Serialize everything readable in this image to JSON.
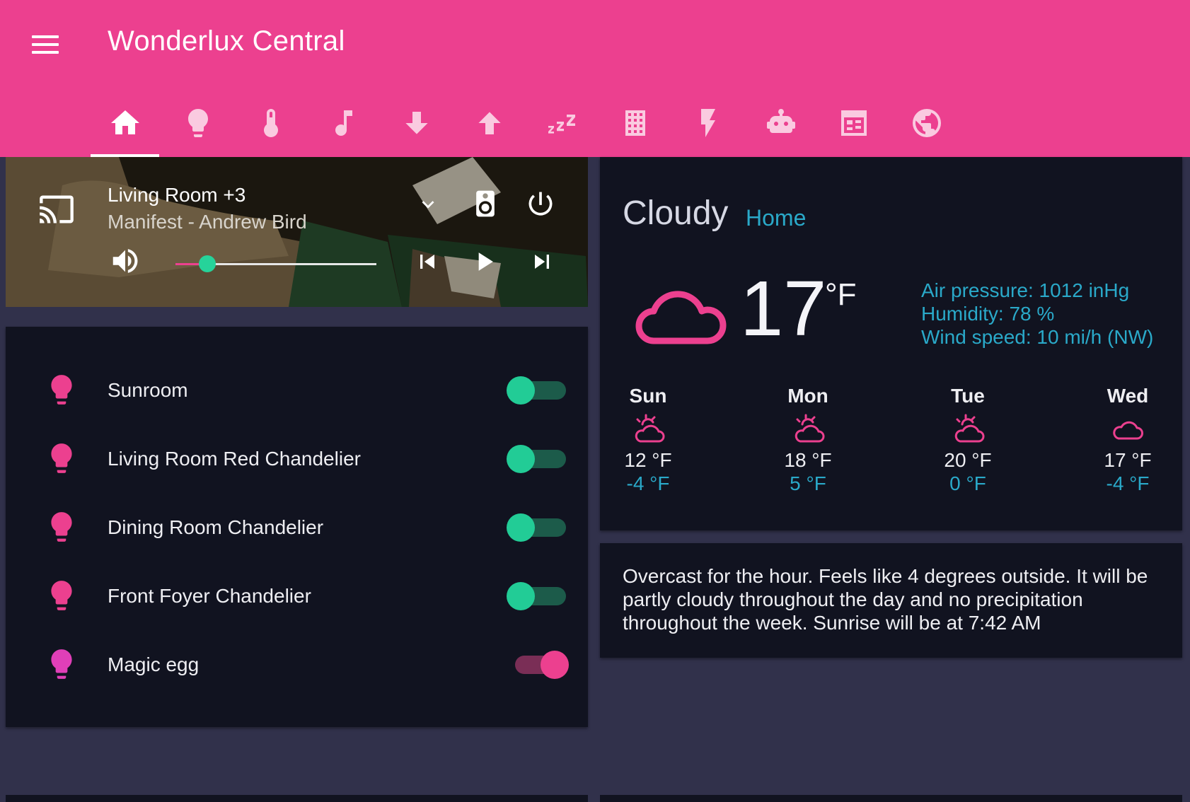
{
  "app": {
    "title": "Wonderlux Central",
    "accent": "#ec408f"
  },
  "tabs": [
    {
      "icon": "home-icon",
      "active": true
    },
    {
      "icon": "lightbulb-icon",
      "active": false
    },
    {
      "icon": "thermometer-icon",
      "active": false
    },
    {
      "icon": "music-note-icon",
      "active": false
    },
    {
      "icon": "arrow-down-icon",
      "active": false
    },
    {
      "icon": "arrow-up-icon",
      "active": false
    },
    {
      "icon": "sleep-icon",
      "active": false
    },
    {
      "icon": "building-icon",
      "active": false
    },
    {
      "icon": "lightning-icon",
      "active": false
    },
    {
      "icon": "robot-icon",
      "active": false
    },
    {
      "icon": "calendar-icon",
      "active": false
    },
    {
      "icon": "globe-icon",
      "active": false
    }
  ],
  "media": {
    "source": "Living Room +3",
    "now_playing": "Manifest - Andrew Bird",
    "volume_fraction": 0.16,
    "icons": [
      "cast-icon",
      "chevron-down-icon",
      "speaker-icon",
      "power-icon",
      "volume-icon",
      "skip-previous-icon",
      "play-icon",
      "skip-next-icon"
    ]
  },
  "lights": [
    {
      "name": "Sunroom",
      "on": false,
      "icon_color": "#ec408f"
    },
    {
      "name": "Living Room Red Chandelier",
      "on": false,
      "icon_color": "#ec408f"
    },
    {
      "name": "Dining Room Chandelier",
      "on": false,
      "icon_color": "#ec408f"
    },
    {
      "name": "Front Foyer Chandelier",
      "on": false,
      "icon_color": "#ec408f"
    },
    {
      "name": "Magic egg",
      "on": true,
      "icon_color": "#e03fb8"
    }
  ],
  "weather": {
    "condition": "Cloudy",
    "location": "Home",
    "temperature": "17",
    "unit": "°F",
    "air_pressure": "Air pressure: 1012 inHg",
    "humidity": "Humidity: 78 %",
    "wind_speed": "Wind speed: 10 mi/h (NW)",
    "forecast": [
      {
        "day": "Sun",
        "high": "12 °F",
        "low": "-4 °F",
        "icon": "partly-cloudy-icon"
      },
      {
        "day": "Mon",
        "high": "18 °F",
        "low": "5 °F",
        "icon": "partly-cloudy-icon"
      },
      {
        "day": "Tue",
        "high": "20 °F",
        "low": "0 °F",
        "icon": "partly-cloudy-icon"
      },
      {
        "day": "Wed",
        "high": "17 °F",
        "low": "-4 °F",
        "icon": "cloud-icon"
      }
    ],
    "summary": "Overcast for the hour. Feels like 4 degrees outside. It will be partly cloudy throughout the day and no precipitation throughout the week. Sunrise will be at 7:42 AM"
  }
}
